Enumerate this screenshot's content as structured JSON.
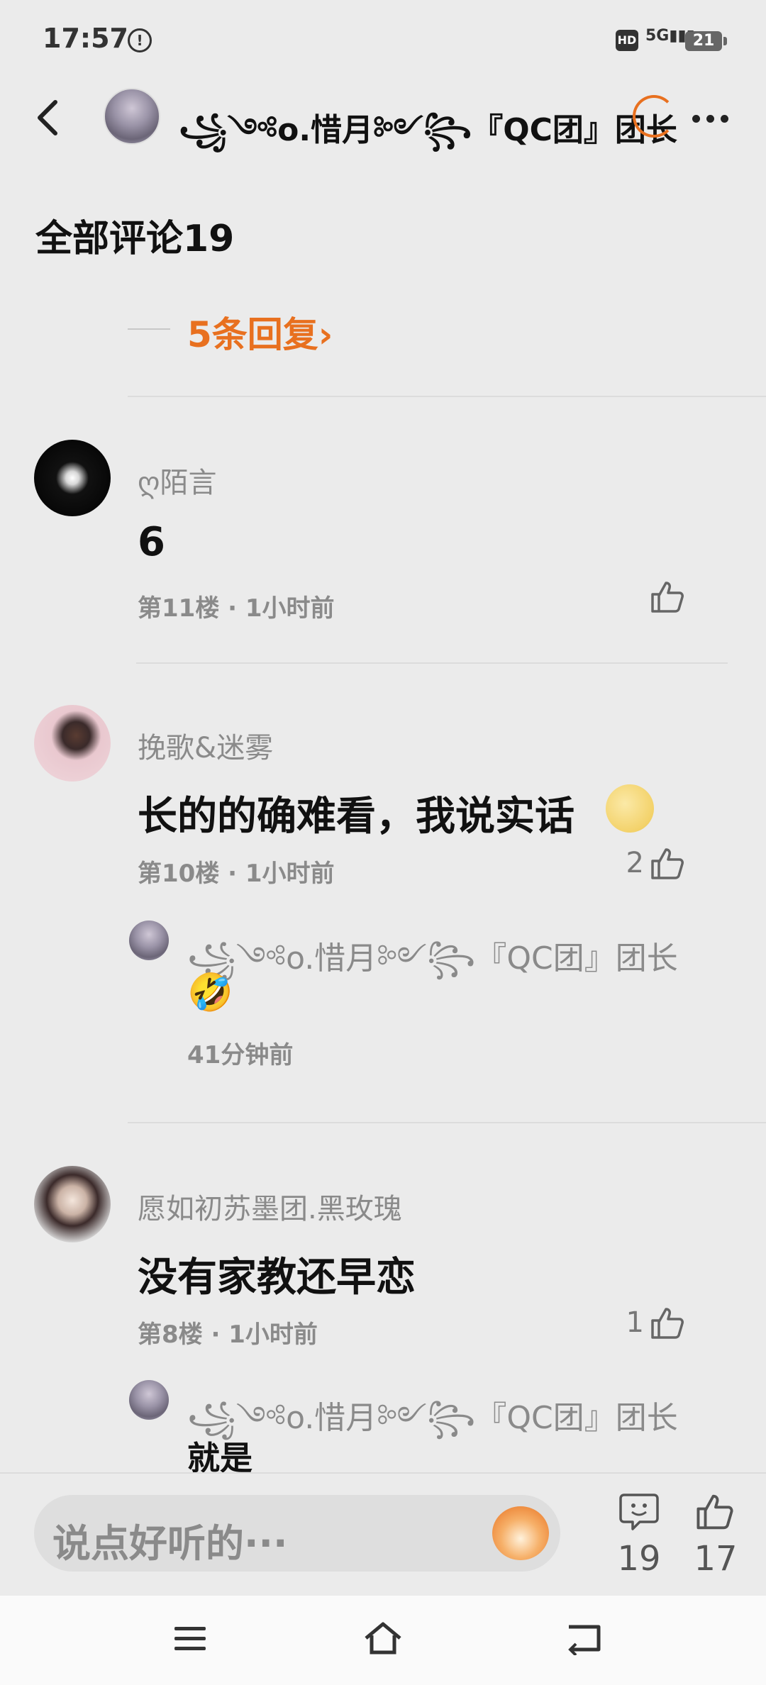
{
  "status_bar": {
    "time": "17:57",
    "network": "5G",
    "battery": "21",
    "hd": "HD"
  },
  "header": {
    "title": "꧁༺o.惜月༻꧂『QC团』团长"
  },
  "section": {
    "title": "全部评论19"
  },
  "replies_link": {
    "label": "5条回复›"
  },
  "comments": [
    {
      "username": "ღ陌言",
      "content": "6",
      "meta": "第11楼 · 1小时前",
      "likes": ""
    },
    {
      "username": "挽歌&迷雾",
      "content": "长的的确难看，我说实话",
      "meta": "第10楼 · 1小时前",
      "likes": "2",
      "reply": {
        "username": "꧁༺o.惜月༻꧂『QC团』团长",
        "content": "🤣",
        "meta": "41分钟前"
      }
    },
    {
      "username": "愿如初苏墨团.黑玫瑰",
      "content": "没有家教还早恋",
      "meta": "第8楼 · 1小时前",
      "likes": "1",
      "reply": {
        "username": "꧁༺o.惜月༻꧂『QC团』团长",
        "content": "就是"
      }
    }
  ],
  "composer": {
    "placeholder": "说点好听的···",
    "comment_count": "19",
    "like_count": "17"
  },
  "colors": {
    "accent": "#e8701f",
    "background": "#ebebeb"
  }
}
